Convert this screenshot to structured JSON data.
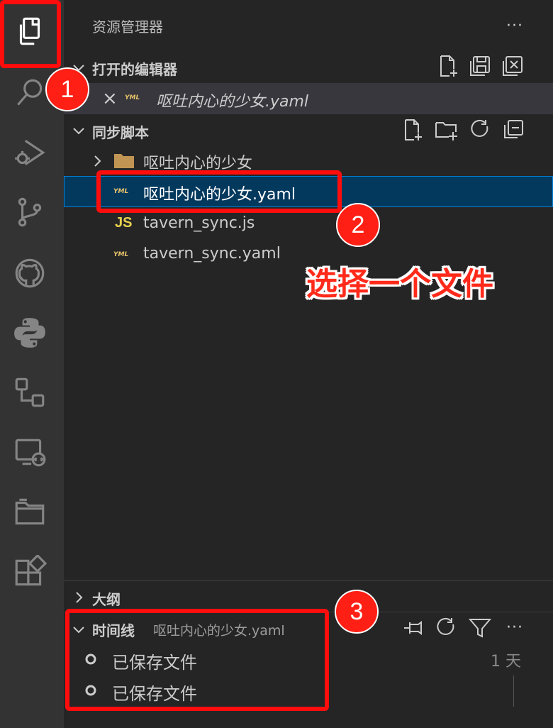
{
  "explorer": {
    "title": "资源管理器",
    "more": "···"
  },
  "open_editors": {
    "title": "打开的编辑器",
    "items": [
      {
        "icon": "yaml-file-icon",
        "icon_text": "YML",
        "label": "呕吐内心的少女.yaml",
        "close": "×"
      }
    ]
  },
  "workspace": {
    "title": "同步脚本",
    "items": [
      {
        "type": "folder",
        "label": "呕吐内心的少女"
      },
      {
        "type": "yaml",
        "icon_text": "YML",
        "label": "呕吐内心的少女.yaml",
        "selected": true
      },
      {
        "type": "js",
        "icon_text": "JS",
        "label": "tavern_sync.js"
      },
      {
        "type": "yaml",
        "icon_text": "YML",
        "label": "tavern_sync.yaml"
      }
    ]
  },
  "outline": {
    "title": "大纲"
  },
  "timeline": {
    "title": "时间线",
    "file": "呕吐内心的少女.yaml",
    "items": [
      {
        "label": "已保存文件",
        "time": "1 天"
      },
      {
        "label": "已保存文件",
        "time": ""
      }
    ]
  },
  "annotations": {
    "badge1": "1",
    "badge2": "2",
    "badge3": "3",
    "callout": "选择一个文件"
  },
  "colors": {
    "activity_bar": "#333333",
    "sidebar": "#252526",
    "selection": "#04395e",
    "selection_border": "#007fd4",
    "annotation_red": "#ff0d0d",
    "open_editor_row": "#37373d"
  }
}
